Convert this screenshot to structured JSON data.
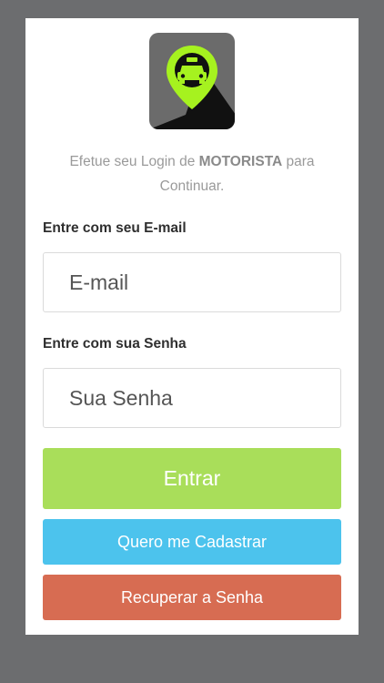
{
  "colors": {
    "background": "#6c6d6f",
    "card": "#ffffff",
    "enter_button": "#a9de5a",
    "register_button": "#4cc3ed",
    "recover_button": "#d76c52",
    "logo_accent": "#a6f21f"
  },
  "logo": {
    "icon": "taxi-pin-icon"
  },
  "intro": {
    "text_before": "Efetue seu Login de ",
    "highlight": "MOTORISTA",
    "text_after": " para Continuar."
  },
  "email": {
    "label": "Entre com seu E-mail",
    "placeholder": "E-mail",
    "value": ""
  },
  "password": {
    "label": "Entre com sua Senha",
    "placeholder": "Sua Senha",
    "value": ""
  },
  "buttons": {
    "enter": "Entrar",
    "register": "Quero me Cadastrar",
    "recover": "Recuperar a Senha"
  }
}
